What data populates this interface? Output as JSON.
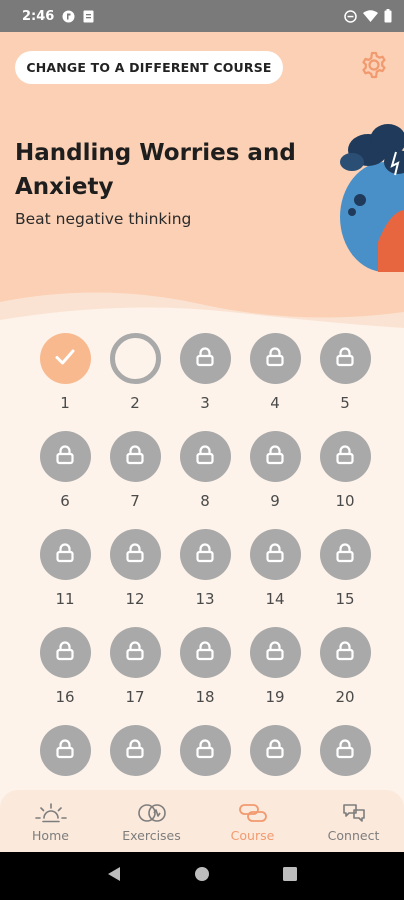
{
  "status_bar": {
    "time": "2:46",
    "icons": [
      "circle-app-icon",
      "document-icon",
      "do-not-disturb-icon",
      "wifi-icon",
      "battery-icon"
    ]
  },
  "header": {
    "change_course_label": "CHANGE TO A DIFFERENT COURSE",
    "settings_icon": "gear-icon",
    "title": "Handling Worries and Anxiety",
    "subtitle": "Beat negative thinking",
    "accent_color": "#fbd0b4"
  },
  "days": [
    {
      "number": "1",
      "state": "done"
    },
    {
      "number": "2",
      "state": "current"
    },
    {
      "number": "3",
      "state": "locked"
    },
    {
      "number": "4",
      "state": "locked"
    },
    {
      "number": "5",
      "state": "locked"
    },
    {
      "number": "6",
      "state": "locked"
    },
    {
      "number": "7",
      "state": "locked"
    },
    {
      "number": "8",
      "state": "locked"
    },
    {
      "number": "9",
      "state": "locked"
    },
    {
      "number": "10",
      "state": "locked"
    },
    {
      "number": "11",
      "state": "locked"
    },
    {
      "number": "12",
      "state": "locked"
    },
    {
      "number": "13",
      "state": "locked"
    },
    {
      "number": "14",
      "state": "locked"
    },
    {
      "number": "15",
      "state": "locked"
    },
    {
      "number": "16",
      "state": "locked"
    },
    {
      "number": "17",
      "state": "locked"
    },
    {
      "number": "18",
      "state": "locked"
    },
    {
      "number": "19",
      "state": "locked"
    },
    {
      "number": "20",
      "state": "locked"
    },
    {
      "number": "",
      "state": "locked"
    },
    {
      "number": "",
      "state": "locked"
    },
    {
      "number": "",
      "state": "locked"
    },
    {
      "number": "",
      "state": "locked"
    },
    {
      "number": "",
      "state": "locked"
    }
  ],
  "bottom_nav": {
    "items": [
      {
        "label": "Home",
        "icon": "sunrise-icon",
        "active": false
      },
      {
        "label": "Exercises",
        "icon": "exercises-icon",
        "active": false
      },
      {
        "label": "Course",
        "icon": "course-icon",
        "active": true
      },
      {
        "label": "Connect",
        "icon": "chat-bubbles-icon",
        "active": false
      }
    ],
    "active_color": "#f29a6f"
  },
  "system_nav": {
    "icons": [
      "back-icon",
      "home-icon",
      "recents-icon"
    ]
  }
}
